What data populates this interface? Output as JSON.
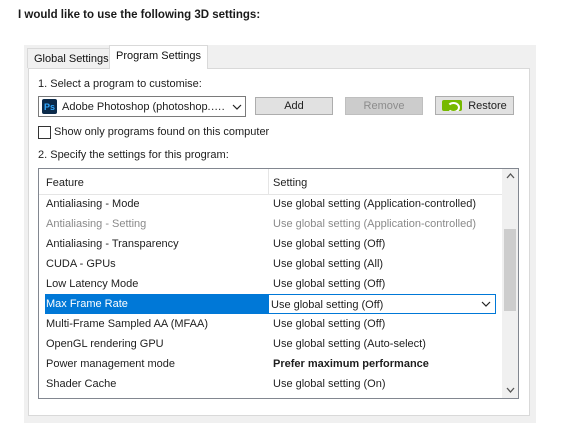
{
  "heading": "I would like to use the following 3D settings:",
  "tabs": [
    {
      "label": "Global Settings",
      "active": false
    },
    {
      "label": "Program Settings",
      "active": true
    }
  ],
  "step1_label": "1. Select a program to customise:",
  "program_combo": {
    "value": "Adobe Photoshop (photoshop.….",
    "icon": "photoshop-icon"
  },
  "buttons": {
    "add": "Add",
    "remove": "Remove",
    "restore": "Restore"
  },
  "checkbox": {
    "label": "Show only programs found on this computer",
    "checked": false
  },
  "step2_label": "2. Specify the settings for this program:",
  "table": {
    "headers": {
      "feature": "Feature",
      "setting": "Setting"
    },
    "rows": [
      {
        "feature": "Antialiasing - Mode",
        "setting": "Use global setting (Application-controlled)",
        "state": "normal"
      },
      {
        "feature": "Antialiasing - Setting",
        "setting": "Use global setting (Application-controlled)",
        "state": "disabled"
      },
      {
        "feature": "Antialiasing - Transparency",
        "setting": "Use global setting (Off)",
        "state": "normal"
      },
      {
        "feature": "CUDA - GPUs",
        "setting": "Use global setting (All)",
        "state": "normal"
      },
      {
        "feature": "Low Latency Mode",
        "setting": "Use global setting (Off)",
        "state": "normal"
      },
      {
        "feature": "Max Frame Rate",
        "setting": "Use global setting (Off)",
        "state": "selected"
      },
      {
        "feature": "Multi-Frame Sampled AA (MFAA)",
        "setting": "Use global setting (Off)",
        "state": "normal"
      },
      {
        "feature": "OpenGL rendering GPU",
        "setting": "Use global setting (Auto-select)",
        "state": "normal"
      },
      {
        "feature": "Power management mode",
        "setting": "Prefer maximum performance",
        "state": "bold"
      },
      {
        "feature": "Shader Cache",
        "setting": "Use global setting (On)",
        "state": "normal"
      }
    ]
  },
  "colors": {
    "selection": "#0078d7",
    "nvidia_green": "#76b900"
  }
}
